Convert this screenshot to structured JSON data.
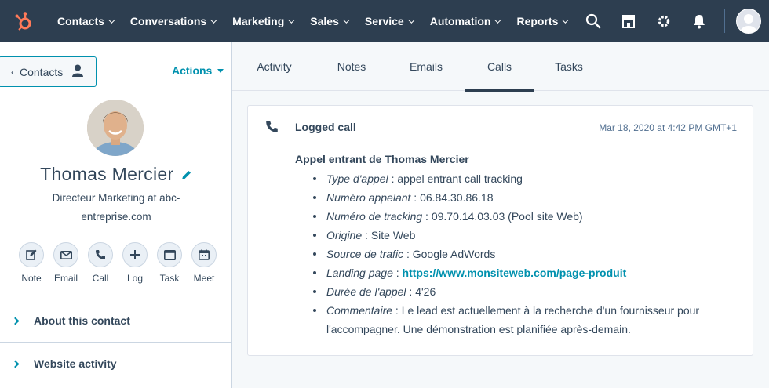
{
  "colors": {
    "nav_bg": "#2d3e50",
    "brand_orange": "#ff7a59",
    "link": "#0091ae",
    "text": "#33475b"
  },
  "topnav": {
    "logo_icon": "hubspot-sprocket-icon",
    "items": [
      {
        "label": "Contacts"
      },
      {
        "label": "Conversations"
      },
      {
        "label": "Marketing"
      },
      {
        "label": "Sales"
      },
      {
        "label": "Service"
      },
      {
        "label": "Automation"
      },
      {
        "label": "Reports"
      }
    ],
    "right_icons": [
      "search-icon",
      "marketplace-icon",
      "settings-gear-icon",
      "notifications-bell-icon",
      "user-avatar-icon"
    ]
  },
  "sidebar": {
    "back_label": "Contacts",
    "actions_label": "Actions",
    "contact_name": "Thomas Mercier",
    "contact_title": "Directeur Marketing at abc-entreprise.com",
    "quick_actions": [
      {
        "label": "Note",
        "icon": "note-edit-icon"
      },
      {
        "label": "Email",
        "icon": "email-envelope-icon"
      },
      {
        "label": "Call",
        "icon": "phone-icon"
      },
      {
        "label": "Log",
        "icon": "plus-icon"
      },
      {
        "label": "Task",
        "icon": "task-icon"
      },
      {
        "label": "Meet",
        "icon": "calendar-icon"
      }
    ],
    "sections": [
      {
        "label": "About this contact"
      },
      {
        "label": "Website activity"
      }
    ]
  },
  "tabs": [
    {
      "label": "Activity"
    },
    {
      "label": "Notes"
    },
    {
      "label": "Emails"
    },
    {
      "label": "Calls",
      "active": true
    },
    {
      "label": "Tasks"
    }
  ],
  "call_card": {
    "title": "Logged call",
    "date": "Mar 18, 2020 at 4:42 PM GMT+1",
    "heading": "Appel entrant de Thomas Mercier",
    "details": [
      {
        "key": "Type d'appel",
        "sep": " : ",
        "value": "appel entrant call tracking"
      },
      {
        "key": "Numéro appelant",
        "sep": " : ",
        "value": "06.84.30.86.18"
      },
      {
        "key": "Numéro de tracking",
        "sep": " : ",
        "value": "09.70.14.03.03 (Pool site Web)"
      },
      {
        "key": "Origine",
        "sep": " : ",
        "value": "Site Web"
      },
      {
        "key": "Source de trafic",
        "sep": " : ",
        "value": "Google AdWords"
      },
      {
        "key": "Landing page",
        "sep": " : ",
        "link": "https://www.monsiteweb.com/page-produit"
      },
      {
        "key": "Durée de l'appel",
        "sep": " : ",
        "value": "4'26"
      },
      {
        "key": "Commentaire",
        "sep": " : ",
        "value": "Le lead est actuellement à la recherche d'un fournisseur pour l'accompagner. Une démonstration est planifiée après-demain."
      }
    ]
  }
}
